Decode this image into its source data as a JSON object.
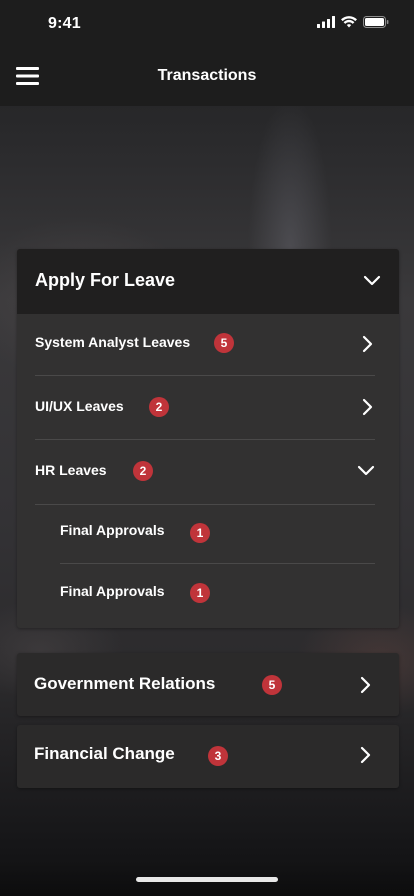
{
  "status_bar": {
    "time": "9:41"
  },
  "header": {
    "title": "Transactions",
    "menu_icon": "hamburger-menu-icon"
  },
  "sections": {
    "apply_for_leave": {
      "title": "Apply For Leave",
      "expanded": true,
      "items": [
        {
          "label": "System Analyst Leaves",
          "count": "5",
          "expanded": false
        },
        {
          "label": "UI/UX Leaves",
          "count": "2",
          "expanded": false
        },
        {
          "label": "HR Leaves",
          "count": "2",
          "expanded": true,
          "children": [
            {
              "label": "Final Approvals",
              "count": "1"
            },
            {
              "label": "Final Approvals",
              "count": "1"
            }
          ]
        }
      ]
    },
    "government_relations": {
      "title": "Government Relations",
      "count": "5"
    },
    "financial_change": {
      "title": "Financial Change",
      "count": "3"
    }
  },
  "colors": {
    "badge": "#c0343a",
    "card": "#2b2a2a",
    "card_header": "#201f1f",
    "bar": "#1d1d1d"
  }
}
